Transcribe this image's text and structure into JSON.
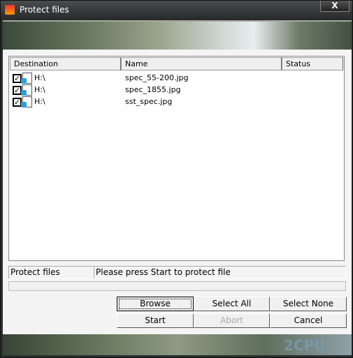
{
  "window": {
    "title": "Protect files",
    "close_label": "X"
  },
  "list": {
    "columns": [
      "Destination",
      "Name",
      "Status"
    ],
    "rows": [
      {
        "checked": true,
        "destination": "H:\\",
        "name": "spec_55-200.jpg",
        "status": ""
      },
      {
        "checked": true,
        "destination": "H:\\",
        "name": "spec_1855.jpg",
        "status": ""
      },
      {
        "checked": true,
        "destination": "H:\\",
        "name": "sst_spec.jpg",
        "status": ""
      }
    ]
  },
  "status": {
    "label": "Protect files",
    "message": "Please press Start to protect file",
    "progress": 0
  },
  "buttons": {
    "browse": "Browse",
    "select_all": "Select All",
    "select_none": "Select None",
    "start": "Start",
    "abort": "Abort",
    "cancel": "Cancel"
  },
  "watermark": "2CPU"
}
